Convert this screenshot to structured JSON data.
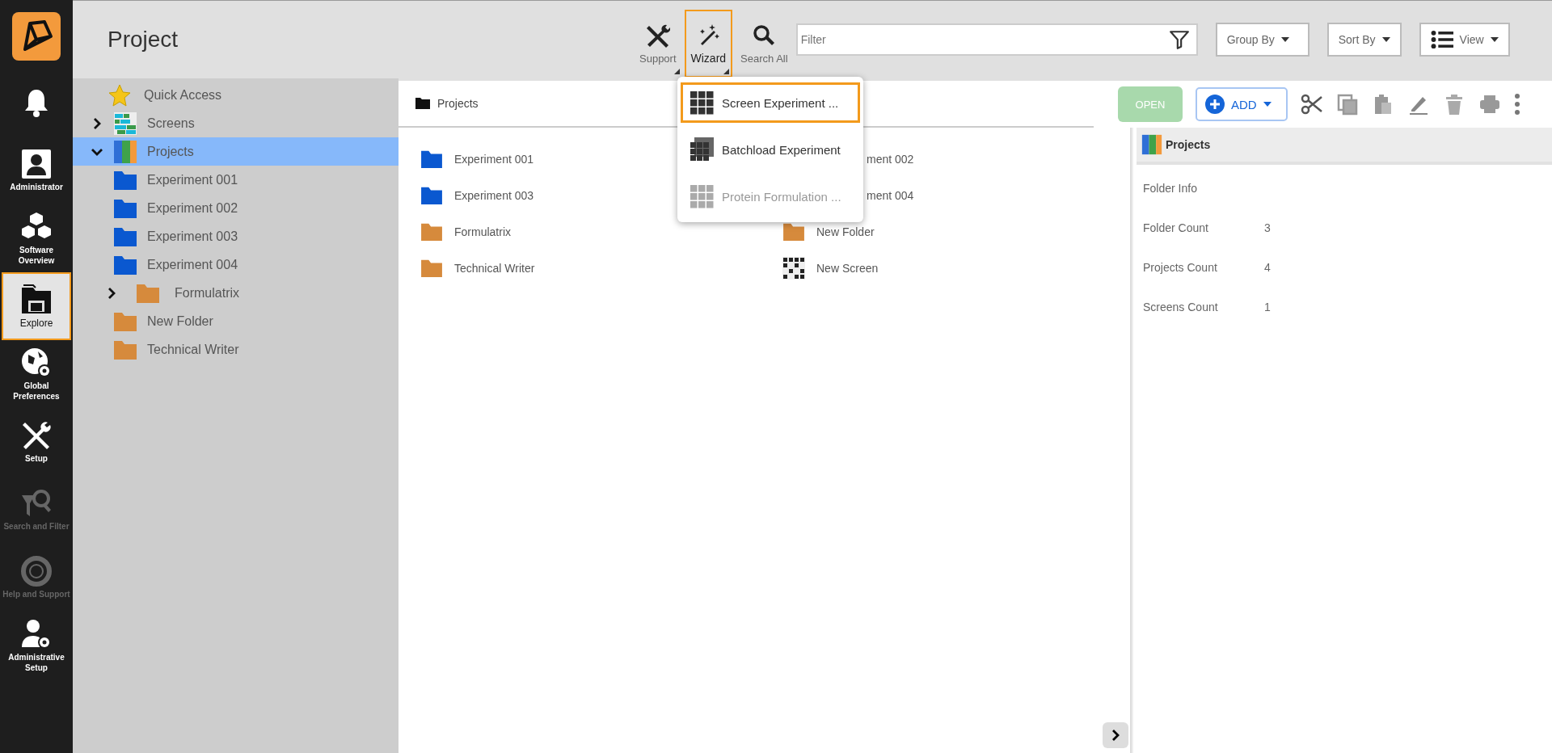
{
  "nav": {
    "items": [
      {
        "selected": false,
        "disabled": false
      },
      {
        "label": "Administrator",
        "selected": false,
        "disabled": false
      },
      {
        "label": "Software Overview",
        "selected": false,
        "disabled": false
      },
      {
        "label": "Explore",
        "selected": true,
        "disabled": false
      },
      {
        "label": "Global Preferences",
        "selected": false,
        "disabled": false
      },
      {
        "label": "Setup",
        "selected": false,
        "disabled": false
      },
      {
        "label": "Search and Filter",
        "selected": false,
        "disabled": true
      },
      {
        "label": "Help and Support",
        "selected": false,
        "disabled": true
      },
      {
        "label": "Administrative Setup",
        "selected": false,
        "disabled": false
      }
    ]
  },
  "header": {
    "title": "Project",
    "tools": [
      {
        "label": "Support",
        "selected": false
      },
      {
        "label": "Wizard",
        "selected": true
      },
      {
        "label": "Search All",
        "selected": false
      }
    ],
    "filter": {
      "placeholder": "Filter"
    },
    "dropdowns": [
      "Group By",
      "Sort By",
      "View"
    ]
  },
  "wizard_menu": [
    {
      "label": "Screen Experiment ...",
      "selected": true,
      "disabled": false
    },
    {
      "label": "Batchload Experiment",
      "selected": false,
      "disabled": false
    },
    {
      "label": "Protein Formulation ...",
      "selected": false,
      "disabled": true
    }
  ],
  "tree": {
    "quick_access": "Quick Access",
    "items": [
      {
        "label": "Screens",
        "kind": "screens",
        "expanded": false,
        "selected": false
      },
      {
        "label": "Projects",
        "kind": "projects",
        "expanded": true,
        "selected": true,
        "children": [
          {
            "label": "Experiment 001",
            "kind": "project"
          },
          {
            "label": "Experiment 002",
            "kind": "project"
          },
          {
            "label": "Experiment 003",
            "kind": "project"
          },
          {
            "label": "Experiment 004",
            "kind": "project"
          },
          {
            "label": "Formulatrix",
            "kind": "folder",
            "expanded": false
          },
          {
            "label": "New Folder",
            "kind": "folder"
          },
          {
            "label": "Technical Writer",
            "kind": "folder"
          }
        ]
      }
    ]
  },
  "breadcrumb": "Projects",
  "toolbar": {
    "open": {
      "label": "OPEN",
      "disabled": true
    },
    "add": "ADD"
  },
  "grid": [
    {
      "label": "Experiment 001",
      "kind": "project"
    },
    {
      "label": "ment 002",
      "kind": "covered"
    },
    {
      "label": "Experiment 003",
      "kind": "project"
    },
    {
      "label": "ment 004",
      "kind": "covered"
    },
    {
      "label": "Formulatrix",
      "kind": "folder"
    },
    {
      "label": "New Folder",
      "kind": "folder"
    },
    {
      "label": "Technical Writer",
      "kind": "folder"
    },
    {
      "label": "New Screen",
      "kind": "screen"
    }
  ],
  "details": {
    "title": "Projects",
    "section": "Folder Info",
    "rows": [
      {
        "label": "Folder Count",
        "value": "3"
      },
      {
        "label": "Projects Count",
        "value": "4"
      },
      {
        "label": "Screens Count",
        "value": "1"
      }
    ]
  }
}
